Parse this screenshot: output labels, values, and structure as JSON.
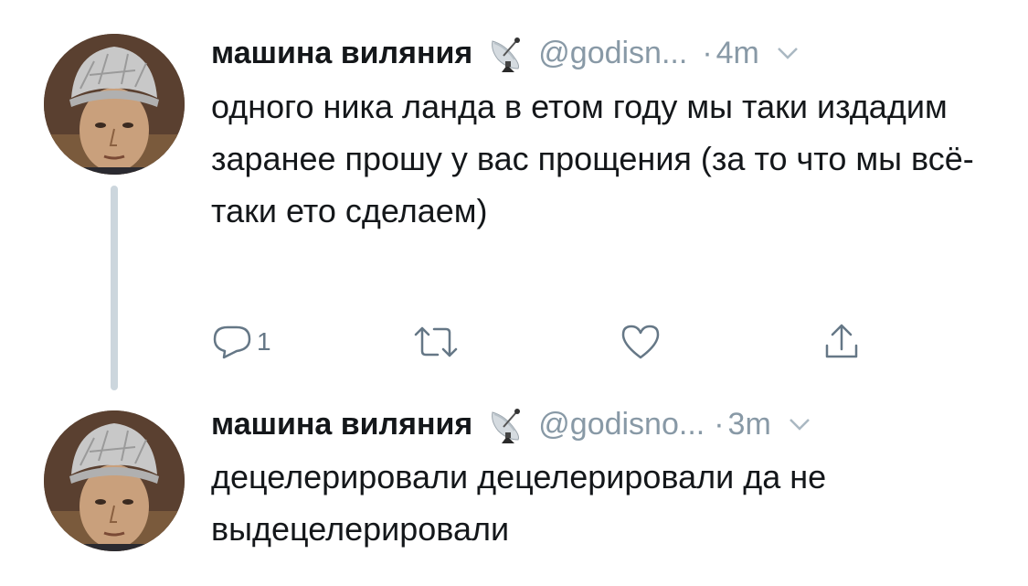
{
  "tweets": [
    {
      "display_name": "машина виляния",
      "handle": "@godisn...",
      "separator": "·",
      "time": "4m",
      "text": "одного ника ланда в етом году мы таки издадим заранее прошу у вас прощения (за то что мы всё-таки ето сделаем)",
      "reply_count": "1"
    },
    {
      "display_name": "машина виляния",
      "handle": "@godisno...",
      "separator": "·",
      "time": "3m",
      "text": "децелерировали децелерировали да не выдецелерировали"
    }
  ],
  "icons": {
    "badge": "satellite-antenna-icon",
    "caret": "chevron-down-icon",
    "reply": "reply-icon",
    "retweet": "retweet-icon",
    "like": "heart-icon",
    "share": "share-icon"
  },
  "colors": {
    "text": "#14171a",
    "secondary": "#8899a6",
    "action_icon": "#657786",
    "thread_line": "#ccd6dd"
  }
}
